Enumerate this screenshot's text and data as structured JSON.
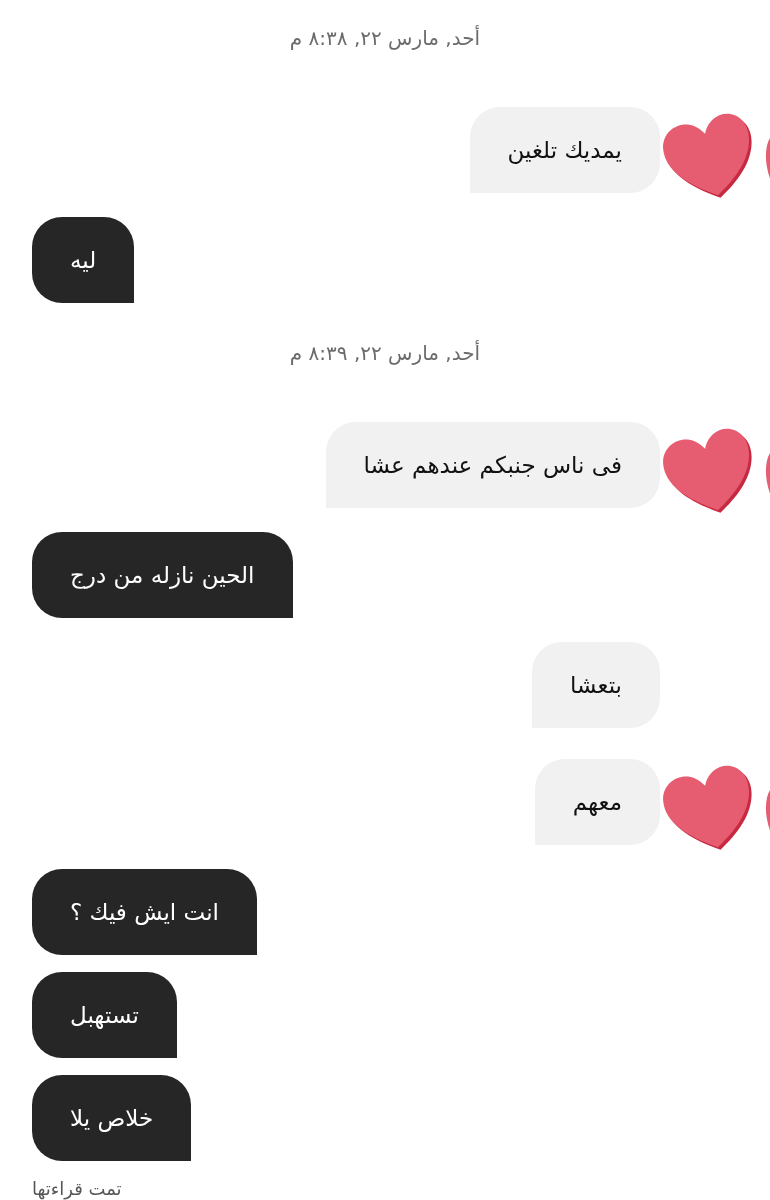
{
  "messages": [
    {
      "kind": "time",
      "text": "أحد, مارس ٢٢, ٨:٣٨ م"
    },
    {
      "kind": "sent",
      "text": "يمديك تلغين",
      "reaction": true
    },
    {
      "kind": "received",
      "text": "ليه"
    },
    {
      "kind": "time",
      "text": "أحد, مارس ٢٢, ٨:٣٩ م"
    },
    {
      "kind": "sent",
      "text": "فى ناس جنبكم عندهم عشا",
      "reaction": true
    },
    {
      "kind": "received",
      "text": "الحين نازله من درج"
    },
    {
      "kind": "sent",
      "text": "بتعشا",
      "reaction": false
    },
    {
      "kind": "sent",
      "text": "معهم",
      "reaction": true
    },
    {
      "kind": "received",
      "text": "انت ايش فيك ؟"
    },
    {
      "kind": "received",
      "text": "تستهبل"
    },
    {
      "kind": "received",
      "text": "خلاص يلا"
    },
    {
      "kind": "seen",
      "text": "تمت قراءتها"
    }
  ]
}
